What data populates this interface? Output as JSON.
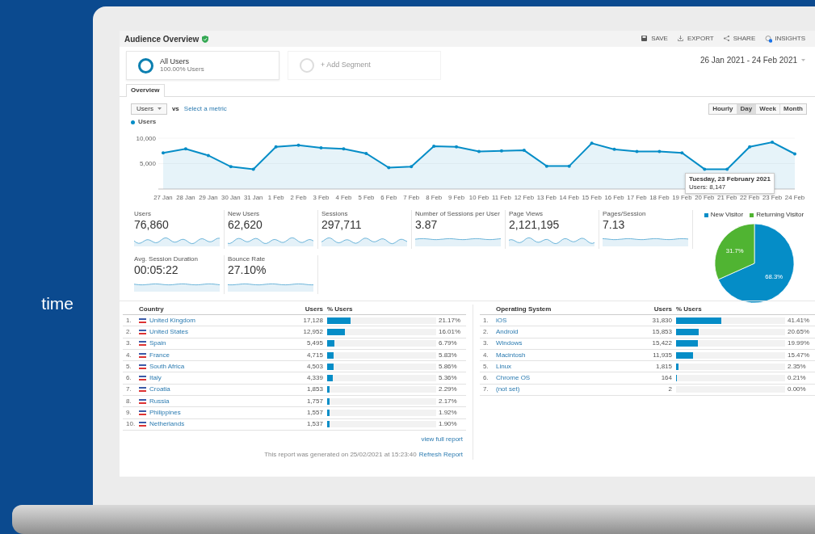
{
  "backdrop": {
    "text": "time"
  },
  "header": {
    "title": "Audience Overview",
    "verified": true,
    "actions": [
      {
        "label": "SAVE"
      },
      {
        "label": "EXPORT"
      },
      {
        "label": "SHARE"
      },
      {
        "label": "INSIGHTS"
      }
    ]
  },
  "segments": [
    {
      "kind": "active",
      "name": "All Users",
      "detail": "100.00% Users"
    },
    {
      "kind": "add",
      "name": "+ Add Segment"
    }
  ],
  "date_range": "26 Jan 2021 - 24 Feb 2021",
  "tabs": [
    {
      "label": "Overview",
      "selected": true
    }
  ],
  "chart_controls": {
    "metric": "Users",
    "vs": "vs",
    "link": "Select a metric",
    "periods": [
      {
        "label": "Hourly",
        "selected": false
      },
      {
        "label": "Day",
        "selected": true
      },
      {
        "label": "Week",
        "selected": false
      },
      {
        "label": "Month",
        "selected": false
      }
    ]
  },
  "chart": {
    "tooltip": {
      "title": "Tuesday, 23 February 2021",
      "reading": "Users: 8,147"
    },
    "chart_data": {
      "type": "area",
      "categories": [
        "27 Jan",
        "28 Jan",
        "29 Jan",
        "30 Jan",
        "31 Jan",
        "1 Feb",
        "2 Feb",
        "3 Feb",
        "4 Feb",
        "5 Feb",
        "6 Feb",
        "7 Feb",
        "8 Feb",
        "9 Feb",
        "10 Feb",
        "11 Feb",
        "12 Feb",
        "13 Feb",
        "14 Feb",
        "15 Feb",
        "16 Feb",
        "17 Feb",
        "18 Feb",
        "19 Feb",
        "20 Feb",
        "21 Feb",
        "22 Feb",
        "23 Feb",
        "24 Feb"
      ],
      "series": [
        {
          "name": "Users",
          "color": "#058dc7",
          "values": [
            7100,
            7900,
            6600,
            4400,
            3900,
            8300,
            8600,
            8100,
            7900,
            7000,
            4200,
            4400,
            8400,
            8300,
            7400,
            7500,
            7600,
            4500,
            4500,
            9000,
            7800,
            7400,
            7400,
            7100,
            3900,
            3900,
            8300,
            9200,
            6900
          ]
        }
      ],
      "ylim": [
        0,
        10000
      ],
      "yticks": [
        {
          "value": 5000,
          "label": "5,000"
        },
        {
          "value": 10000,
          "label": "10,000"
        }
      ]
    }
  },
  "metrics": [
    {
      "label": "Users",
      "value": "76,860",
      "kind": "wavy"
    },
    {
      "label": "New Users",
      "value": "62,620",
      "kind": "wavy"
    },
    {
      "label": "Sessions",
      "value": "297,711",
      "kind": "wavy"
    },
    {
      "label": "Number of Sessions per User",
      "value": "3.87",
      "kind": "flat"
    },
    {
      "label": "Page Views",
      "value": "2,121,195",
      "kind": "wavy"
    },
    {
      "label": "Pages/Session",
      "value": "7.13",
      "kind": "flat"
    },
    {
      "label": "Avg. Session Duration",
      "value": "00:05:22",
      "kind": "flat"
    },
    {
      "label": "Bounce Rate",
      "value": "27.10%",
      "kind": "flat"
    }
  ],
  "visitor_chart": {
    "chart_data": {
      "type": "pie",
      "categories": [
        "New Visitor",
        "Returning Visitor"
      ],
      "colors": [
        "#058dc7",
        "#50b432"
      ],
      "values": [
        68.3,
        31.7
      ],
      "value_labels": [
        "68.3%",
        "31.7%"
      ]
    }
  },
  "country_table": {
    "columns": [
      "Country",
      "Users",
      "% Users"
    ],
    "rows": [
      {
        "rank": "1.",
        "name": "United Kingdom",
        "users": "17,128",
        "share": "21.17%",
        "level": 0.2117
      },
      {
        "rank": "2.",
        "name": "United States",
        "users": "12,952",
        "share": "16.01%",
        "level": 0.1601
      },
      {
        "rank": "3.",
        "name": "Spain",
        "users": "5,495",
        "share": "6.79%",
        "level": 0.0679
      },
      {
        "rank": "4.",
        "name": "France",
        "users": "4,715",
        "share": "5.83%",
        "level": 0.0583
      },
      {
        "rank": "5.",
        "name": "South Africa",
        "users": "4,503",
        "share": "5.86%",
        "level": 0.0586
      },
      {
        "rank": "6.",
        "name": "Italy",
        "users": "4,339",
        "share": "5.36%",
        "level": 0.0536
      },
      {
        "rank": "7.",
        "name": "Croatia",
        "users": "1,853",
        "share": "2.29%",
        "level": 0.0229
      },
      {
        "rank": "8.",
        "name": "Russia",
        "users": "1,757",
        "share": "2.17%",
        "level": 0.0217
      },
      {
        "rank": "9.",
        "name": "Philippines",
        "users": "1,557",
        "share": "1.92%",
        "level": 0.0192
      },
      {
        "rank": "10.",
        "name": "Netherlands",
        "users": "1,537",
        "share": "1.90%",
        "level": 0.019
      }
    ],
    "more_link": "view full report",
    "note": "This report was generated on 25/02/2021 at 15:23:40",
    "note_link": "Refresh Report"
  },
  "os_table": {
    "columns": [
      "Operating System",
      "Users",
      "% Users"
    ],
    "rows": [
      {
        "rank": "1.",
        "name": "iOS",
        "users": "31,830",
        "share": "41.41%",
        "level": 0.4141
      },
      {
        "rank": "2.",
        "name": "Android",
        "users": "15,853",
        "share": "20.65%",
        "level": 0.2065
      },
      {
        "rank": "3.",
        "name": "Windows",
        "users": "15,422",
        "share": "19.99%",
        "level": 0.1999
      },
      {
        "rank": "4.",
        "name": "Macintosh",
        "users": "11,935",
        "share": "15.47%",
        "level": 0.1547
      },
      {
        "rank": "5.",
        "name": "Linux",
        "users": "1,815",
        "share": "2.35%",
        "level": 0.0235
      },
      {
        "rank": "6.",
        "name": "Chrome OS",
        "users": "164",
        "share": "0.21%",
        "level": 0.0021
      },
      {
        "rank": "7.",
        "name": "(not set)",
        "users": "2",
        "share": "0.00%",
        "level": 0
      }
    ]
  }
}
